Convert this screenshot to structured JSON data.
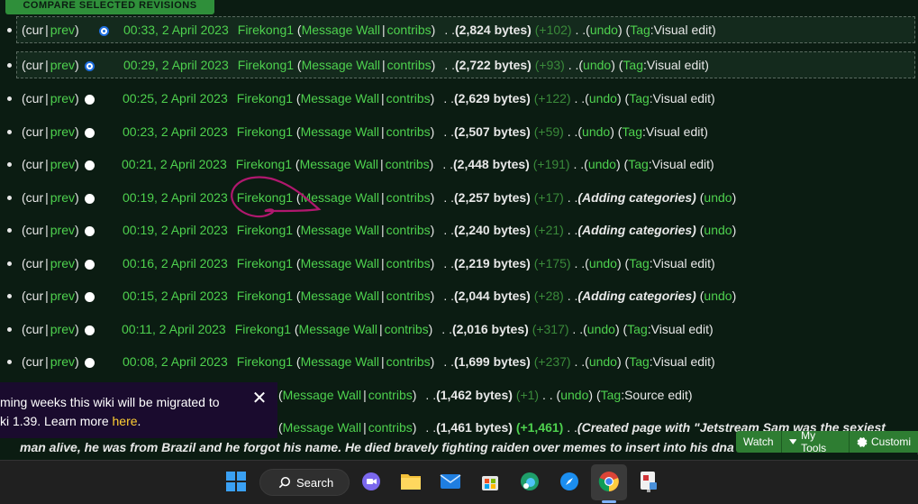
{
  "compare_button": "COMPARE SELECTED REVISIONS",
  "revisions": [
    {
      "cur": "cur",
      "prev": "prev",
      "radio": "on",
      "time": "00:33, 2 April 2023",
      "user": "Firekong1",
      "wall": "Message Wall",
      "contribs": "contribs",
      "bytes": "(2,824 bytes)",
      "diff": "(+102)",
      "summary": "",
      "undo": "undo",
      "tag_label": "Tag",
      "tag_value": "Visual edit",
      "selected": true
    },
    {
      "cur": "cur",
      "prev": "prev",
      "radio": "on",
      "time": "00:29, 2 April 2023",
      "user": "Firekong1",
      "wall": "Message Wall",
      "contribs": "contribs",
      "bytes": "(2,722 bytes)",
      "diff": "(+93)",
      "summary": "",
      "undo": "undo",
      "tag_label": "Tag",
      "tag_value": "Visual edit",
      "selected": true
    },
    {
      "cur": "cur",
      "prev": "prev",
      "radio": "off",
      "time": "00:25, 2 April 2023",
      "user": "Firekong1",
      "wall": "Message Wall",
      "contribs": "contribs",
      "bytes": "(2,629 bytes)",
      "diff": "(+122)",
      "summary": "",
      "undo": "undo",
      "tag_label": "Tag",
      "tag_value": "Visual edit",
      "selected": false
    },
    {
      "cur": "cur",
      "prev": "prev",
      "radio": "off",
      "time": "00:23, 2 April 2023",
      "user": "Firekong1",
      "wall": "Message Wall",
      "contribs": "contribs",
      "bytes": "(2,507 bytes)",
      "diff": "(+59)",
      "summary": "",
      "undo": "undo",
      "tag_label": "Tag",
      "tag_value": "Visual edit",
      "selected": false
    },
    {
      "cur": "cur",
      "prev": "prev",
      "radio": "off",
      "time": "00:21, 2 April 2023",
      "user": "Firekong1",
      "wall": "Message Wall",
      "contribs": "contribs",
      "bytes": "(2,448 bytes)",
      "diff": "(+191)",
      "summary": "",
      "undo": "undo",
      "tag_label": "Tag",
      "tag_value": "Visual edit",
      "selected": false
    },
    {
      "cur": "cur",
      "prev": "prev",
      "radio": "off",
      "time": "00:19, 2 April 2023",
      "user": "Firekong1",
      "wall": "Message Wall",
      "contribs": "contribs",
      "bytes": "(2,257 bytes)",
      "diff": "(+17)",
      "summary": "(Adding categories)",
      "undo": "undo",
      "tag_label": "",
      "tag_value": "",
      "selected": false
    },
    {
      "cur": "cur",
      "prev": "prev",
      "radio": "off",
      "time": "00:19, 2 April 2023",
      "user": "Firekong1",
      "wall": "Message Wall",
      "contribs": "contribs",
      "bytes": "(2,240 bytes)",
      "diff": "(+21)",
      "summary": "(Adding categories)",
      "undo": "undo",
      "tag_label": "",
      "tag_value": "",
      "selected": false
    },
    {
      "cur": "cur",
      "prev": "prev",
      "radio": "off",
      "time": "00:16, 2 April 2023",
      "user": "Firekong1",
      "wall": "Message Wall",
      "contribs": "contribs",
      "bytes": "(2,219 bytes)",
      "diff": "(+175)",
      "summary": "",
      "undo": "undo",
      "tag_label": "Tag",
      "tag_value": "Visual edit",
      "selected": false
    },
    {
      "cur": "cur",
      "prev": "prev",
      "radio": "off",
      "time": "00:15, 2 April 2023",
      "user": "Firekong1",
      "wall": "Message Wall",
      "contribs": "contribs",
      "bytes": "(2,044 bytes)",
      "diff": "(+28)",
      "summary": "(Adding categories)",
      "undo": "undo",
      "tag_label": "",
      "tag_value": "",
      "selected": false
    },
    {
      "cur": "cur",
      "prev": "prev",
      "radio": "off",
      "time": "00:11, 2 April 2023",
      "user": "Firekong1",
      "wall": "Message Wall",
      "contribs": "contribs",
      "bytes": "(2,016 bytes)",
      "diff": "(+317)",
      "summary": "",
      "undo": "undo",
      "tag_label": "Tag",
      "tag_value": "Visual edit",
      "selected": false
    },
    {
      "cur": "cur",
      "prev": "prev",
      "radio": "off",
      "time": "00:08, 2 April 2023",
      "user": "Firekong1",
      "wall": "Message Wall",
      "contribs": "contribs",
      "bytes": "(1,699 bytes)",
      "diff": "(+237)",
      "summary": "",
      "undo": "undo",
      "tag_label": "Tag",
      "tag_value": "Visual edit",
      "selected": false
    }
  ],
  "partial_rows": [
    {
      "wall": "Message Wall",
      "contribs": "contribs",
      "bytes": "(1,462 bytes)",
      "diff": "(+1)",
      "undo": "undo",
      "tag_label": "Tag",
      "tag_value": "Source edit"
    },
    {
      "wall": "Message Wall",
      "contribs": "contribs",
      "bytes": "(1,461 bytes)",
      "diff": "(+1,461)",
      "summary": "(Created page with \"Jetstream Sam was the sexiest"
    }
  ],
  "wrap_line": "man alive, he was from Brazil and he forgot his name. He died bravely fighting raiden over memes to insert into his dna and soul. There was blooshed,",
  "toast": {
    "line1": "ming weeks this wiki will be migrated to",
    "line2_prefix": "ki 1.39. Learn more ",
    "link": "here",
    "line2_suffix": ".",
    "close": "✕"
  },
  "toolbar": {
    "watch": "Watch",
    "my_tools": "My Tools",
    "customize": "Customi"
  },
  "taskbar": {
    "search_label": "Search"
  },
  "colors": {
    "link": "#4ed14e",
    "background": "#0b1c12",
    "accent_button": "#2f8f3a",
    "annotation": "#b0186e"
  }
}
